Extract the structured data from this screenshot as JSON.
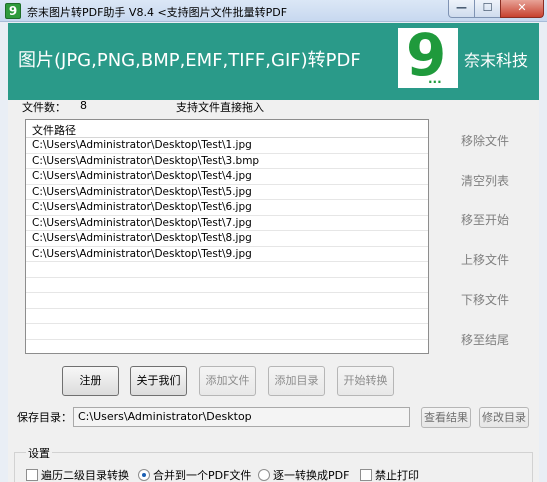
{
  "window": {
    "app_icon": "9",
    "title": "奈末图片转PDF助手 V8.4   <支持图片文件批量转PDF",
    "controls": {
      "minimize": "—",
      "maximize": "☐",
      "close": "✕"
    }
  },
  "banner": {
    "title": "图片(JPG,PNG,BMP,EMF,TIFF,GIF)转PDF",
    "logo_glyph": "9",
    "logo_dots": "...",
    "brand": "奈末科技",
    "color": "#2a9a89"
  },
  "file_info": {
    "count_label": "文件数：",
    "count_value": "8",
    "drag_hint": "支持文件直接拖入"
  },
  "file_list": {
    "column_header": "文件路径",
    "rows": [
      "C:\\Users\\Administrator\\Desktop\\Test\\1.jpg",
      "C:\\Users\\Administrator\\Desktop\\Test\\3.bmp",
      "C:\\Users\\Administrator\\Desktop\\Test\\4.jpg",
      "C:\\Users\\Administrator\\Desktop\\Test\\5.jpg",
      "C:\\Users\\Administrator\\Desktop\\Test\\6.jpg",
      "C:\\Users\\Administrator\\Desktop\\Test\\7.jpg",
      "C:\\Users\\Administrator\\Desktop\\Test\\8.jpg",
      "C:\\Users\\Administrator\\Desktop\\Test\\9.jpg"
    ]
  },
  "side_actions": {
    "remove": "移除文件",
    "clear": "清空列表",
    "move_top": "移至开始",
    "move_up": "上移文件",
    "move_down": "下移文件",
    "move_bottom": "移至结尾"
  },
  "buttons": {
    "register": "注册",
    "about": "关于我们",
    "add_files": "添加文件",
    "add_folder": "添加目录",
    "start": "开始转换"
  },
  "save": {
    "label": "保存目录：",
    "path": "C:\\Users\\Administrator\\Desktop",
    "view_result": "查看结果",
    "change_dir": "修改目录"
  },
  "settings": {
    "title": "设置",
    "traverse_subdirs": "遍历二级目录转换",
    "merge_one_pdf": "合并到一个PDF文件",
    "convert_each": "逐一转换成PDF",
    "disable_print": "禁止打印"
  }
}
